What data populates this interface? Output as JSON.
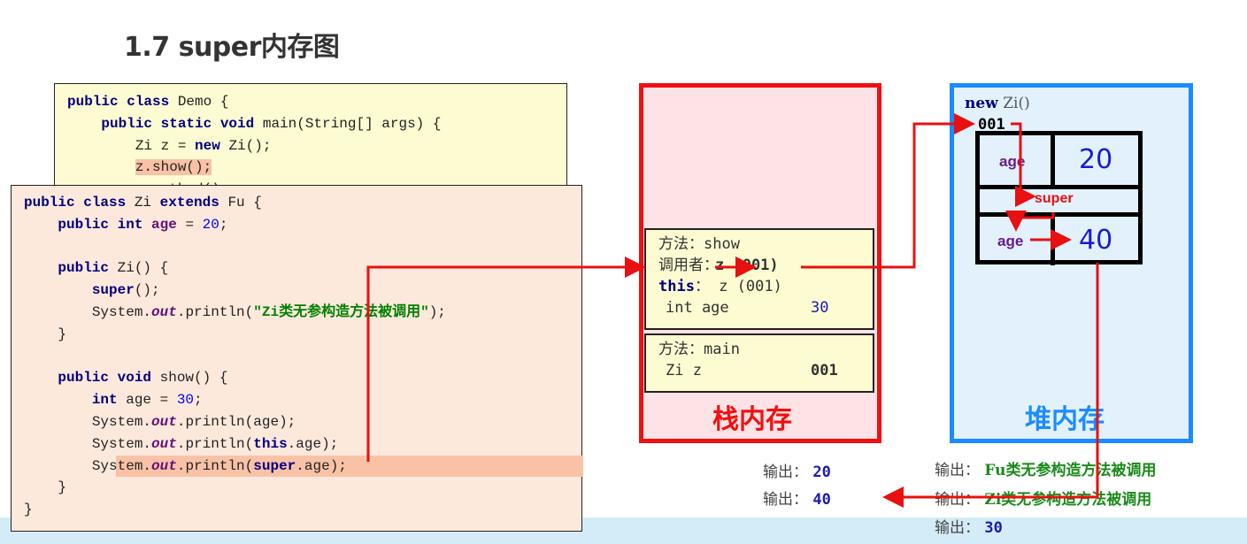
{
  "title": "1.7 super内存图",
  "demo_code": [
    [
      [
        "public class ",
        "kw"
      ],
      [
        "Demo {",
        ""
      ]
    ],
    [
      [
        "    public static void ",
        "kw"
      ],
      [
        "main(String[] args) {",
        ""
      ]
    ],
    [
      [
        "        Zi z = ",
        ""
      ],
      [
        "new ",
        "kw"
      ],
      [
        "Zi();",
        ""
      ]
    ],
    {
      "hl": true,
      "tokens": [
        [
          "        ",
          ""
        ],
        [
          "z.show();",
          "hl"
        ]
      ]
    },
    [
      [
        "        z.method();",
        ""
      ]
    ]
  ],
  "zi_code": [
    [
      [
        "public class ",
        "kw"
      ],
      [
        "Zi ",
        ""
      ],
      [
        "extends ",
        "kw"
      ],
      [
        "Fu {",
        ""
      ]
    ],
    [
      [
        "    public int ",
        "kw"
      ],
      [
        "age",
        "fld"
      ],
      [
        " = ",
        ""
      ],
      [
        "20",
        "num"
      ],
      [
        ";",
        ""
      ]
    ],
    [
      [
        "",
        ""
      ]
    ],
    [
      [
        "    public ",
        "kw"
      ],
      [
        "Zi() {",
        ""
      ]
    ],
    [
      [
        "        ",
        ""
      ],
      [
        "super",
        "kw"
      ],
      [
        "();",
        ""
      ]
    ],
    [
      [
        "        System.",
        ""
      ],
      [
        "out",
        "st"
      ],
      [
        ".println(",
        ""
      ],
      [
        "\"Zi类无参构造方法被调用\"",
        "str"
      ],
      [
        ");",
        ""
      ]
    ],
    [
      [
        "    }",
        ""
      ]
    ],
    [
      [
        "",
        ""
      ]
    ],
    [
      [
        "    public void ",
        "kw"
      ],
      [
        "show() {",
        ""
      ]
    ],
    [
      [
        "        ",
        ""
      ],
      [
        "int ",
        "kw"
      ],
      [
        "age = ",
        ""
      ],
      [
        "30",
        "num"
      ],
      [
        ";",
        ""
      ]
    ],
    [
      [
        "        System.",
        ""
      ],
      [
        "out",
        "st"
      ],
      [
        ".println(age);",
        ""
      ]
    ],
    [
      [
        "        System.",
        ""
      ],
      [
        "out",
        "st"
      ],
      [
        ".println(",
        ""
      ],
      [
        "this",
        "kw"
      ],
      [
        ".age);",
        ""
      ]
    ],
    {
      "hl": true,
      "tokens": [
        [
          "        System.",
          ""
        ],
        [
          "out",
          "st"
        ],
        [
          ".println(",
          ""
        ],
        [
          "super",
          "kw"
        ],
        [
          ".age);",
          ""
        ]
      ]
    },
    [
      [
        "    }",
        ""
      ]
    ],
    [
      [
        "}",
        ""
      ]
    ]
  ],
  "stack": {
    "label": "栈内存",
    "show_frame": {
      "method": "方法：show",
      "caller_label": "调用者：",
      "caller_value": "z (001)",
      "this_label": "this",
      "this_value": "：  z (001)",
      "var_name": "int age",
      "var_value": "30"
    },
    "main_frame": {
      "method": "方法：main",
      "var_name": "Zi z",
      "var_value": "001"
    }
  },
  "heap": {
    "label": "堆内存",
    "new_kw": "new",
    "new_expr": "Zi()",
    "address": "001",
    "field_name": "age",
    "field_value": "20",
    "super_label": "super",
    "super_field_name": "age",
    "super_field_value": "40"
  },
  "outputs_left": [
    {
      "label": "输出： ",
      "value": "20"
    },
    {
      "label": "输出： ",
      "value": "40"
    }
  ],
  "outputs_right": [
    {
      "label": "输出： ",
      "value": "Fu类无参构造方法被调用"
    },
    {
      "label": "输出： ",
      "value": "Zi类无参构造方法被调用"
    },
    {
      "label": "输出： ",
      "value": "30"
    }
  ],
  "colors": {
    "stack_border": "#f01010",
    "heap_border": "#1a8cff",
    "arrow": "#e81010"
  }
}
